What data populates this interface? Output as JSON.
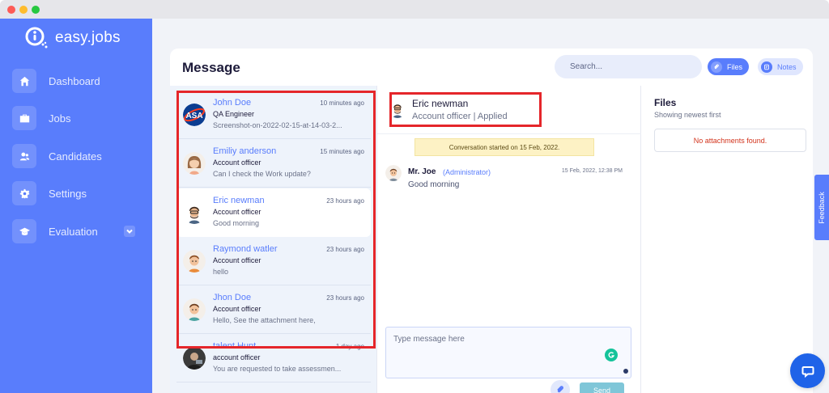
{
  "app": {
    "name": "easy.jobs"
  },
  "colors": {
    "brand": "#597dfc",
    "highlight_box": "#e5262a",
    "help_bubble": "#1f63e8"
  },
  "sidebar": {
    "items": [
      {
        "label": "Dashboard",
        "icon": "home-icon"
      },
      {
        "label": "Jobs",
        "icon": "briefcase-icon"
      },
      {
        "label": "Candidates",
        "icon": "users-icon"
      },
      {
        "label": "Settings",
        "icon": "gear-icon"
      },
      {
        "label": "Evaluation",
        "icon": "graduation-cap-icon",
        "has_dropdown": true
      }
    ]
  },
  "header": {
    "title": "Message",
    "search_placeholder": "Search...",
    "files_label": "Files",
    "notes_label": "Notes"
  },
  "conversations": [
    {
      "name": "John Doe",
      "time": "10 minutes ago",
      "role": "QA Engineer",
      "message": "Screenshot-on-2022-02-15-at-14-03-2..."
    },
    {
      "name": "Emiliy anderson",
      "time": "15 minutes ago",
      "role": "Account officer",
      "message": "Can I check the Work update?"
    },
    {
      "name": "Eric newman",
      "time": "23 hours ago",
      "role": "Account officer",
      "message": "Good morning",
      "active": true
    },
    {
      "name": "Raymond watler",
      "time": "23 hours ago",
      "role": "Account officer",
      "message": "hello"
    },
    {
      "name": "Jhon Doe",
      "time": "23 hours ago",
      "role": "Account officer",
      "message": "Hello, See the attachment here,"
    },
    {
      "name": "talent Hunt",
      "time": "1 day ago",
      "role": "account officer",
      "message": "You are requested to take assessmen..."
    }
  ],
  "chat": {
    "name": "Eric newman",
    "subtitle": "Account officer | Applied",
    "started_notice": "Conversation started on 15 Feb, 2022.",
    "messages": [
      {
        "from": "Mr. Joe",
        "role": "(Administrator)",
        "time": "15 Feb, 2022, 12:38 PM",
        "text": "Good morning"
      }
    ],
    "composer_placeholder": "Type message here",
    "send_label": "Send"
  },
  "files_panel": {
    "title": "Files",
    "subtitle": "Showing newest first",
    "empty_text": "No attachments found."
  },
  "feedback_label": "Feedback"
}
